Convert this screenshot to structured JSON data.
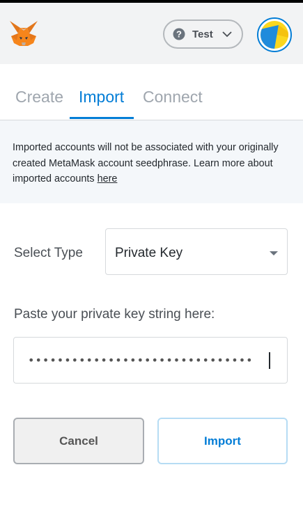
{
  "header": {
    "network_label": "Test"
  },
  "tabs": [
    {
      "label": "Create"
    },
    {
      "label": "Import"
    },
    {
      "label": "Connect"
    }
  ],
  "notice": {
    "text": "Imported accounts will not be associated with your originally created MetaMask account seedphrase. Learn more about imported accounts ",
    "link_text": "here"
  },
  "select_type": {
    "label": "Select Type",
    "value": "Private Key"
  },
  "private_key": {
    "label": "Paste your private key string here:",
    "value": "•••••••••••••••••••••••••••••••"
  },
  "buttons": {
    "cancel": "Cancel",
    "import": "Import"
  },
  "colors": {
    "accent": "#037dd6",
    "header_bg": "#f2f3f4",
    "notice_bg": "#f4f7fa"
  }
}
